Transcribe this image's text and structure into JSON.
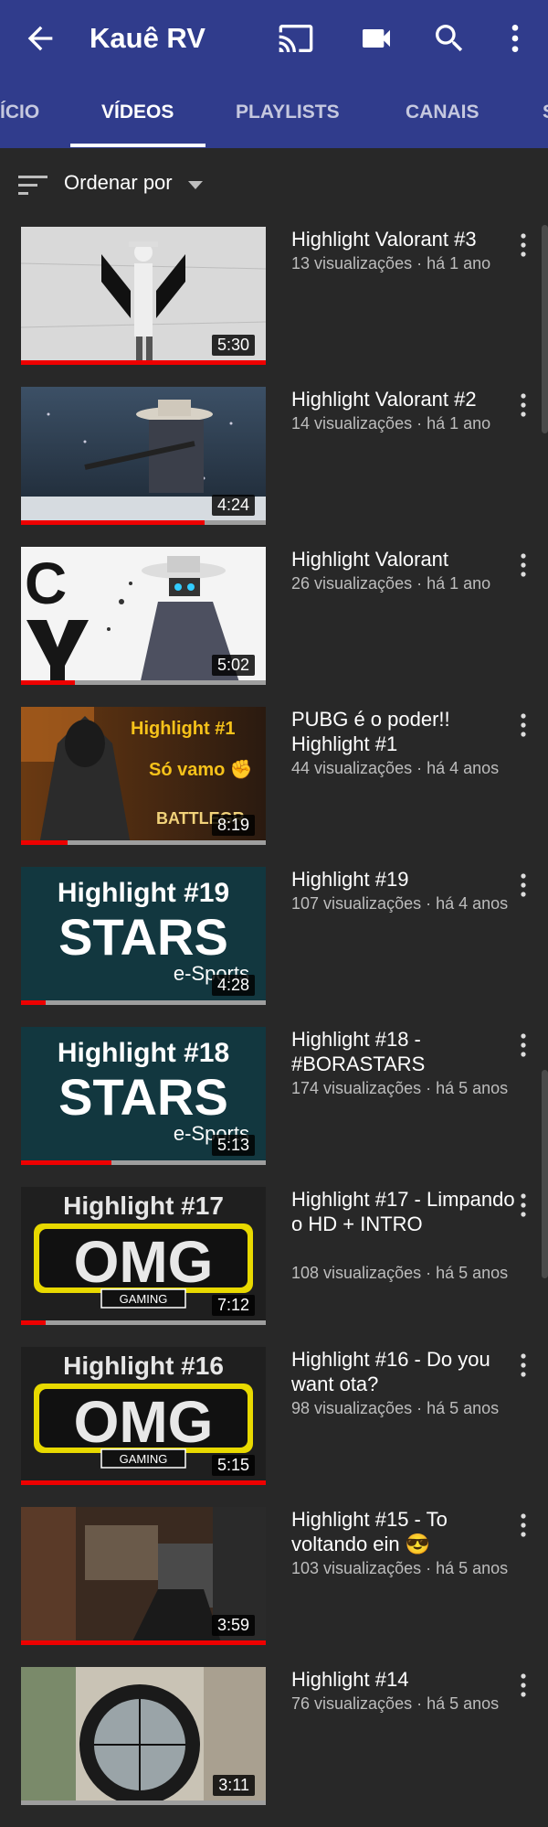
{
  "header": {
    "title": "Kauê RV",
    "icons": [
      "back-arrow-icon",
      "cast-icon",
      "video-camera-icon",
      "search-icon",
      "more-vert-icon"
    ]
  },
  "tabs": [
    {
      "label": "ÍCIO"
    },
    {
      "label": "VÍDEOS",
      "active": true
    },
    {
      "label": "PLAYLISTS"
    },
    {
      "label": "CANAIS"
    },
    {
      "label": "S"
    }
  ],
  "sort": {
    "label": "Ordenar por"
  },
  "colors": {
    "appbar": "#303c8c",
    "background": "#282828",
    "progress": "#ee0000"
  },
  "videos": [
    {
      "title": "Highlight Valorant #3",
      "meta": "13 visualizações · há 1 ano",
      "duration": "5:30",
      "watched": 1.0,
      "title_lines": 1
    },
    {
      "title": "Highlight Valorant #2",
      "meta": "14 visualizações · há 1 ano",
      "duration": "4:24",
      "watched": 0.75,
      "title_lines": 1
    },
    {
      "title": "Highlight Valorant",
      "meta": "26 visualizações · há 1 ano",
      "duration": "5:02",
      "watched": 0.22,
      "title_lines": 1
    },
    {
      "title": "PUBG é o poder!! Highlight #1",
      "meta": "44 visualizações · há 4 anos",
      "duration": "8:19",
      "watched": 0.19,
      "title_lines": 2
    },
    {
      "title": "Highlight #19",
      "meta": "107 visualizações · há 4 anos",
      "duration": "4:28",
      "watched": 0.1,
      "title_lines": 1
    },
    {
      "title": "Highlight #18 - #BORASTARS",
      "meta": "174 visualizações · há 5 anos",
      "duration": "5:13",
      "watched": 0.37,
      "title_lines": 2
    },
    {
      "title": "Highlight #17 - Limpando o HD + INTRO",
      "meta": "108 visualizações · há 5 anos",
      "duration": "7:12",
      "watched": 0.1,
      "title_lines": 3
    },
    {
      "title": "Highlight #16 - Do you want ota?",
      "meta": "98 visualizações · há 5 anos",
      "duration": "5:15",
      "watched": 1.0,
      "title_lines": 2
    },
    {
      "title": "Highlight #15 - To voltando ein 😎",
      "meta": "103 visualizações · há 5 anos",
      "duration": "3:59",
      "watched": 1.0,
      "title_lines": 2
    },
    {
      "title": "Highlight #14",
      "meta": "76 visualizações · há 5 anos",
      "duration": "3:11",
      "watched": 0.0,
      "title_lines": 1
    }
  ],
  "thumb_texts": {
    "pubg_top": "Highlight #1",
    "pubg_mid": "Só vamo ✊",
    "pubg_logo": "BATTLEGR",
    "stars19_top": "Highlight #19",
    "stars18_top": "Highlight #18",
    "stars_main": "STARS",
    "stars_sub": "e-Sports",
    "omg17_top": "Highlight #17",
    "omg16_top": "Highlight #16",
    "omg_main": "OMG",
    "omg_sub": "GAMING",
    "valorant_logo": "C"
  }
}
